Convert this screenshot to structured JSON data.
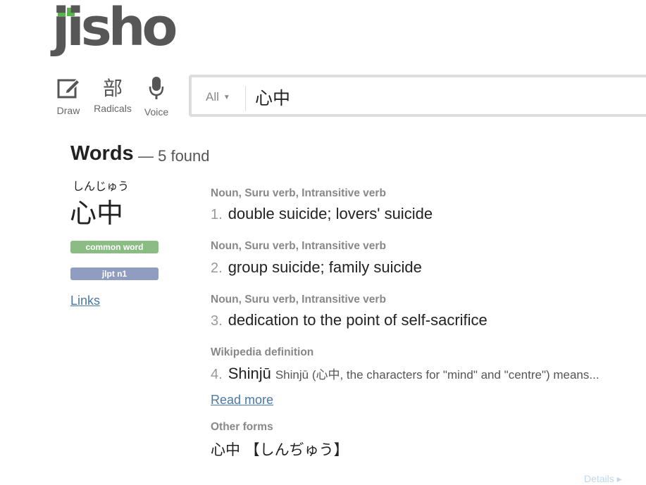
{
  "logo": {
    "text": "jisho"
  },
  "tools": {
    "draw": {
      "label": "Draw",
      "icon": "pencil-edit-icon"
    },
    "radicals": {
      "label": "Radicals",
      "glyph": "部"
    },
    "voice": {
      "label": "Voice",
      "icon": "microphone-icon"
    }
  },
  "search": {
    "filter": "All",
    "value": "心中"
  },
  "results": {
    "title": "Words",
    "count_text": "— 5 found"
  },
  "concept": {
    "furigana": "しんじゅう",
    "kanji": "心中",
    "tags": [
      "common word",
      "jlpt n1"
    ],
    "links_label": "Links"
  },
  "meanings": [
    {
      "tags": "Noun, Suru verb, Intransitive verb",
      "num": "1.",
      "text": "double suicide; lovers' suicide"
    },
    {
      "tags": "Noun, Suru verb, Intransitive verb",
      "num": "2.",
      "text": "group suicide; family suicide"
    },
    {
      "tags": "Noun, Suru verb, Intransitive verb",
      "num": "3.",
      "text": "dedication to the point of self-sacrifice"
    },
    {
      "tags": "Wikipedia definition",
      "num": "4.",
      "text": "Shinjū",
      "abstract": "Shinjū (心中, the characters for \"mind\" and \"centre\") means..."
    }
  ],
  "read_more": "Read more",
  "other_forms": {
    "label": "Other forms",
    "text": "心中 【しんぢゅう】"
  },
  "details_link": "Details ▸",
  "colors": {
    "logo_green": "#56b848",
    "common_tag": "#8abc83",
    "jlpt_tag": "#909dc0",
    "link": "#4a78a8"
  }
}
